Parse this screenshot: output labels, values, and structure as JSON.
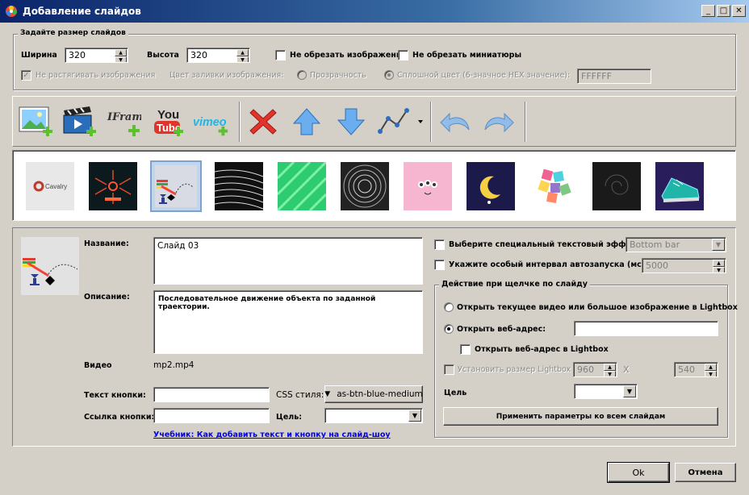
{
  "window": {
    "title": "Добавление слайдов"
  },
  "size_group": {
    "legend": "Задайте размер слайдов",
    "width_label": "Ширина",
    "width_value": "320",
    "height_label": "Высота",
    "height_value": "320",
    "no_crop_images": "Не обрезать изображения",
    "no_crop_thumbs": "Не обрезать миниатюры",
    "no_stretch": "Не растягивать изображения",
    "fill_color_label": "Цвет заливки изображения:",
    "transparency": "Прозрачность",
    "solid_color": "Сплошной цвет (6-значное HEX значение):",
    "hex_value": "FFFFFF"
  },
  "toolbar": {
    "iframe_text": "IFrame",
    "youtube_text_1": "You",
    "youtube_text_2": "Tube",
    "vimeo_text": "vimeo"
  },
  "thumbnails": {
    "cavalry_text": "Cavalry"
  },
  "details": {
    "name_label": "Название:",
    "name_value": "Слайд 03",
    "desc_label": "Описание:",
    "desc_value": "Последовательное движение объекта по заданной траектории.",
    "video_label": "Видео",
    "video_value": "mp2.mp4",
    "button_text_label": "Текст кнопки:",
    "button_text_value": "",
    "css_style_label": "CSS стиля:",
    "css_style_value": "as-btn-blue-medium",
    "button_link_label": "Ссылка кнопки:",
    "button_link_value": "",
    "target_label": "Цель:",
    "target_value": "",
    "tutorial_link": "Учебник: Как добавить текст и кнопку на слайд-шоу"
  },
  "options": {
    "text_effect_label": "Выберите специальный текстовый эффект",
    "text_effect_value": "Bottom bar",
    "autoplay_label": "Укажите особый интервал автозапуска (мсек):",
    "autoplay_value": "5000",
    "click_group_legend": "Действие при щелчке по слайду",
    "open_lightbox": "Открыть текущее видео или большое изображение в Lightbox",
    "open_url": "Открыть веб-адрес:",
    "url_value": "",
    "open_url_lightbox": "Открыть веб-адрес в Lightbox",
    "set_lightbox_size": "Установить размер Lightbox",
    "lightbox_width": "960",
    "times": "X",
    "lightbox_height": "540",
    "target_label": "Цель",
    "target_value": "",
    "apply_all": "Применить параметры ко всем слайдам"
  },
  "footer": {
    "ok": "Ok",
    "cancel": "Отмена"
  },
  "colors": {
    "titlebar": "#0a246a",
    "face": "#d4d0c8",
    "accent_green": "#5cc12d",
    "delete_red": "#e0352b",
    "arrow_blue": "#4a90d9"
  }
}
